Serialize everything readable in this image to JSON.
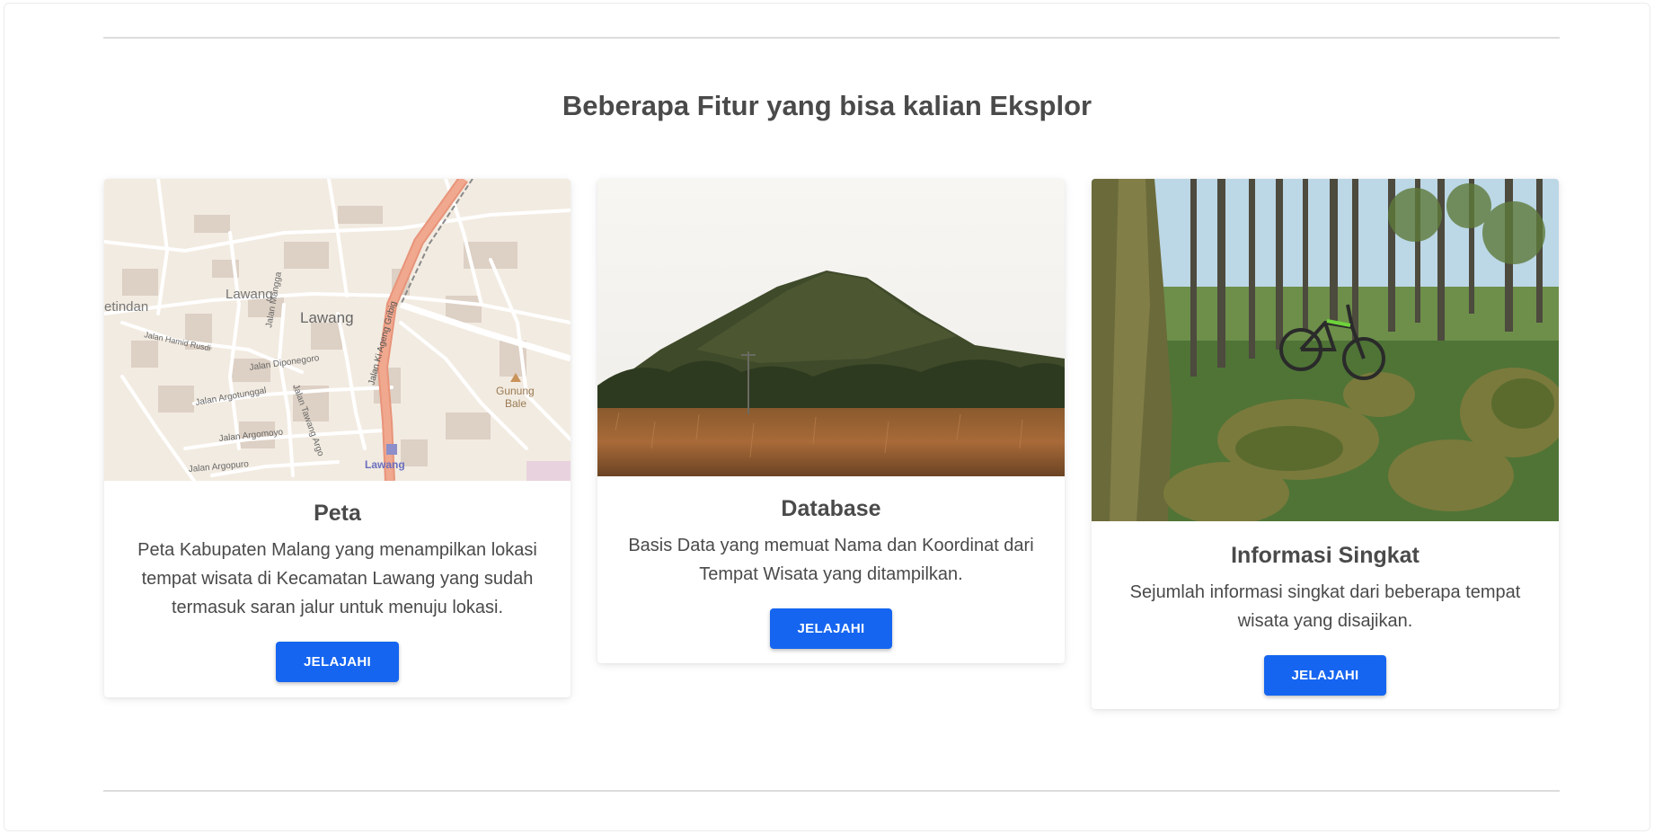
{
  "section": {
    "title": "Beberapa Fitur yang bisa kalian Eksplor"
  },
  "cards": [
    {
      "title": "Peta",
      "description": "Peta Kabupaten Malang yang menampilkan lokasi tempat wisata di Kecamatan Lawang yang sudah termasuk saran jalur untuk menuju lokasi.",
      "button_label": "JELAJAHI",
      "map_labels": {
        "town": "Lawang",
        "town_small": "Lawang",
        "left_edge": "etindan",
        "street1": "Jalan Hamid Rusdi",
        "street2": "Jalan Diponegoro",
        "street3": "Jalan Argotunggal",
        "street4": "Jalan Argomoyo",
        "street5": "Jalan Argopuro",
        "street6": "Jalan Mangga",
        "street7": "Jalan Tawang Argo",
        "highway": "Jalan Ki Ageng Gribig",
        "peak_line1": "Gunung",
        "peak_line2": "Bale",
        "station": "Lawang"
      }
    },
    {
      "title": "Database",
      "description": "Basis Data yang memuat Nama dan Koordinat dari Tempat Wisata yang ditampilkan.",
      "button_label": "JELAJAHI"
    },
    {
      "title": "Informasi Singkat",
      "description": "Sejumlah informasi singkat dari beberapa tempat wisata yang disajikan.",
      "button_label": "JELAJAHI"
    }
  ],
  "colors": {
    "button": "#1565f0",
    "text": "#4a4a4a",
    "divider": "#dcdcdc"
  }
}
